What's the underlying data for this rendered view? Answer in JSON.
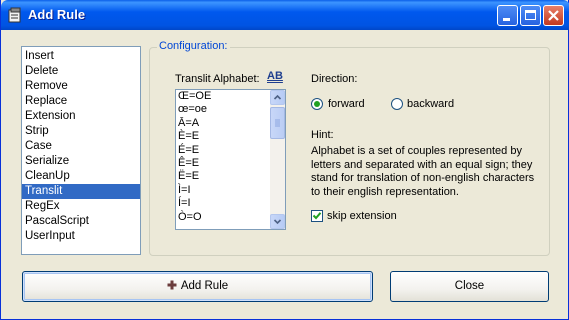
{
  "window": {
    "title": "Add Rule"
  },
  "rule_list": {
    "items": [
      "Insert",
      "Delete",
      "Remove",
      "Replace",
      "Extension",
      "Strip",
      "Case",
      "Serialize",
      "CleanUp",
      "Translit",
      "RegEx",
      "PascalScript",
      "UserInput"
    ],
    "selected": "Translit"
  },
  "config": {
    "group_label": "Configuration:",
    "alphabet_label": "Translit Alphabet:",
    "alphabet_icon_label": "AB",
    "alphabet_lines": [
      "Œ=OE",
      "œ=oe",
      "Ā=A",
      "È=E",
      "É=E",
      "Ê=E",
      "Ë=E",
      "Ì=I",
      "Í=I",
      "Ò=O"
    ],
    "direction_label": "Direction:",
    "direction_forward": "forward",
    "direction_backward": "backward",
    "direction_selected": "forward",
    "hint_label": "Hint:",
    "hint_text": "Alphabet is a set of couples represented by letters and separated with an equal sign; they stand for translation of non-english characters to their english representation.",
    "skip_extension_label": "skip extension",
    "skip_extension_checked": true
  },
  "buttons": {
    "add_rule": "Add Rule",
    "close": "Close"
  },
  "colors": {
    "titlebar": "#0054E3",
    "selection": "#316AC5",
    "group_label": "#0046D5",
    "face": "#ECE9D8"
  }
}
